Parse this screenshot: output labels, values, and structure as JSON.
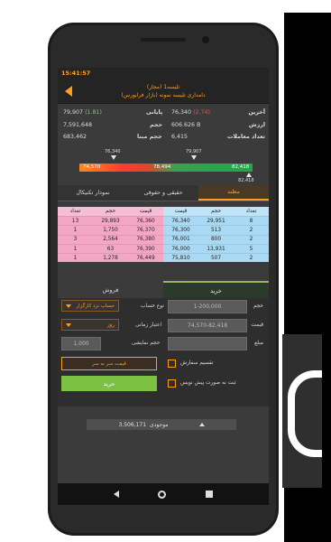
{
  "status": {
    "time": "15:41:57"
  },
  "header": {
    "title": "تلیسه1 (مجاز)",
    "subtitle": "دامداری تلیسه نمونه (بازار فرابورس)"
  },
  "stats": {
    "last_label": "آخرین",
    "last_value": "76,340",
    "last_change": "(2.74)",
    "close_label": "پایانی",
    "close_value": "79,907",
    "close_change": "(1.81)",
    "value_label": "ارزش",
    "value_value": "606.626 B",
    "volume_label": "حجم",
    "volume_value": "7,591,648",
    "trades_label": "تعداد معاملات",
    "trades_value": "6,415",
    "base_volume_label": "حجم مبنا",
    "base_volume_value": "683,462"
  },
  "range": {
    "low": "74,570",
    "high": "82,418",
    "mid": "78,494",
    "marker_left": "76,340",
    "marker_right": "79,907",
    "bottom_right": "82,418"
  },
  "tabs": {
    "summary": "مظنه",
    "legal_real": "حقیقی و حقوقی",
    "technical": "نمودار تکنیکال"
  },
  "orderbook": {
    "sell_headers": [
      "تعداد",
      "حجم",
      "قیمت"
    ],
    "buy_headers": [
      "قیمت",
      "حجم",
      "تعداد"
    ],
    "sell_rows": [
      [
        "13",
        "29,893",
        "76,360"
      ],
      [
        "1",
        "1,750",
        "76,370"
      ],
      [
        "3",
        "2,564",
        "76,380"
      ],
      [
        "1",
        "63",
        "76,390"
      ],
      [
        "1",
        "1,278",
        "76,449"
      ]
    ],
    "buy_rows": [
      [
        "76,340",
        "29,951",
        "8"
      ],
      [
        "76,300",
        "513",
        "2"
      ],
      [
        "76,001",
        "800",
        "2"
      ],
      [
        "76,000",
        "13,931",
        "5"
      ],
      [
        "75,810",
        "507",
        "2"
      ]
    ]
  },
  "trade": {
    "buy_tab": "خرید",
    "sell_tab": "فروش",
    "volume_label": "حجم",
    "volume_placeholder": "1-200,000",
    "price_label": "قیمت",
    "price_placeholder": "74,570-82,418",
    "amount_label": "مبلغ",
    "account_type_label": "نوع حساب",
    "account_type_value": "حساب نزد کارگزار",
    "validity_label": "اعتبار زمانی",
    "validity_value": "روز",
    "display_volume_label": "حجم نمایشی",
    "display_volume_value": "1,000",
    "split_order_label": "تقسیم سفارش",
    "draft_label": "ثبت به صورت پیش نویس",
    "price_per_box": "قیمت سر به سر",
    "buy_button": "خرید"
  },
  "balance": {
    "label": "موجودی",
    "value": "3,506,171"
  }
}
